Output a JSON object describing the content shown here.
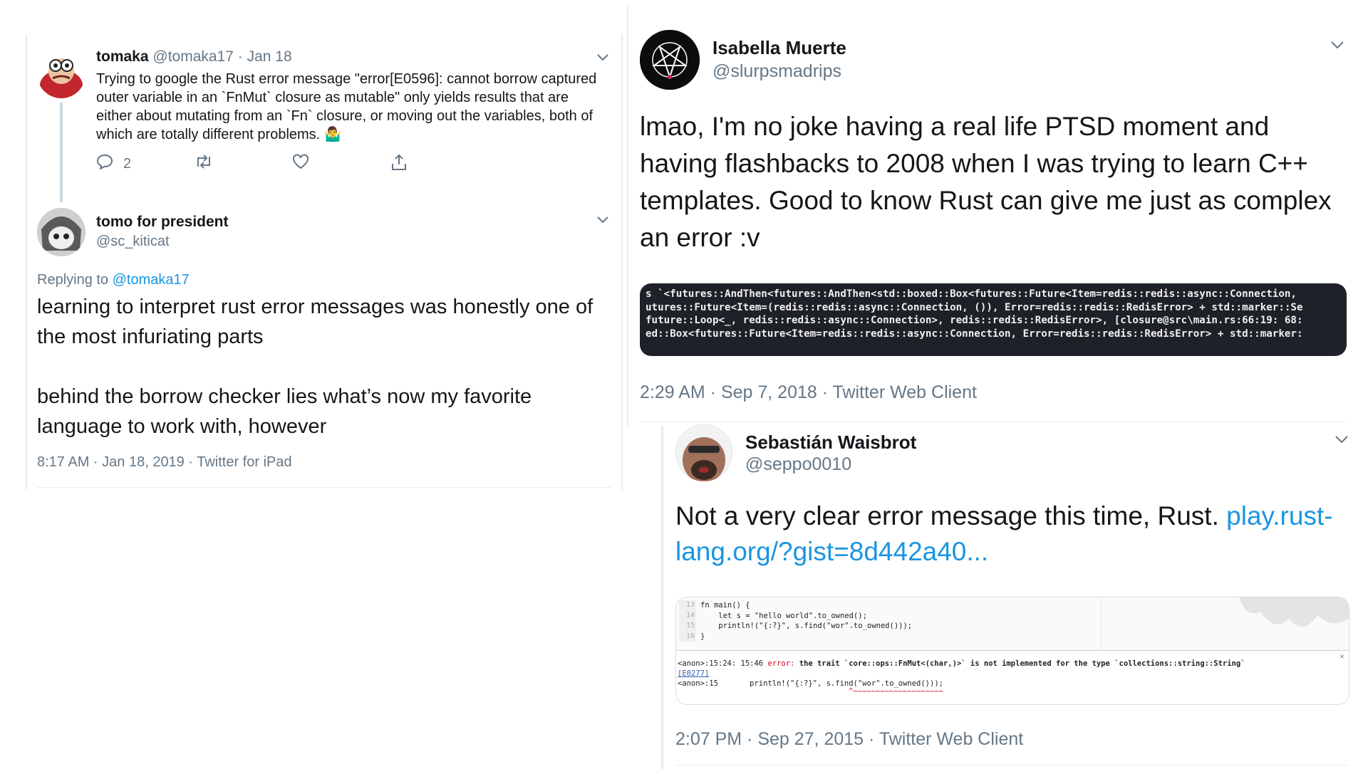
{
  "left": {
    "tweet1": {
      "display_name": "tomaka",
      "handle": "@tomaka17",
      "date": "· Jan 18",
      "text": "Trying to google the Rust error message \"error[E0596]: cannot borrow captured outer variable in an `FnMut` closure as mutable\" only yields results that are either about mutating from an `Fn` closure, or moving out the variables, both of which are totally different problems. 🤷‍♂️",
      "reply_count": "2"
    },
    "tweet2": {
      "display_name": "tomo for president",
      "handle": "@sc_kiticat",
      "replying_prefix": "Replying to ",
      "replying_to": "@tomaka17",
      "text_para1": "learning to interpret rust error messages was honestly one of the most infuriating parts",
      "text_para2": "behind the borrow checker lies what’s now my favorite language to work with, however",
      "meta": "8:17 AM · Jan 18, 2019 · Twitter for iPad"
    }
  },
  "right": {
    "tweet3": {
      "display_name": "Isabella Muerte",
      "handle": "@slurpsmadrips",
      "text": "lmao, I'm no joke having a real life PTSD moment and having flashbacks to 2008 when I was trying to learn C++ templates. Good to know Rust can give me just as complex an error :v",
      "code_lines": [
        "s `<futures::AndThen<futures::AndThen<std::boxed::Box<futures::Future<Item=redis::redis::async::Connection,",
        "utures::Future<Item=(redis::redis::async::Connection, ()), Error=redis::redis::RedisError> + std::marker::Se",
        "future::Loop<_, redis::redis::async::Connection>, redis::redis::RedisError>, [closure@src\\main.rs:66:19: 68:",
        "ed::Box<futures::Future<Item=redis::redis::async::Connection, Error=redis::redis::RedisError> + std::marker:"
      ],
      "meta": "2:29 AM · Sep 7, 2018 · Twitter Web Client"
    },
    "tweet4": {
      "display_name": "Sebastián Waisbrot",
      "handle": "@seppo0010",
      "text_prefix": "Not a very clear error message this time, Rust. ",
      "link": "play.rust-lang.org/?gist=8d442a40...",
      "code": {
        "line_numbers": [
          "13",
          "14",
          "15",
          "16"
        ],
        "lines": [
          "fn main() {",
          "    let s = \"hello world\".to_owned();",
          "    println!(\"{:?}\", s.find(\"wor\".to_owned()));",
          "}"
        ],
        "error_loc": "<anon>:15:24: 15:46 ",
        "error_word": "error:",
        "error_msg": " the trait `core::ops::FnMut<(char,)>` is not implemented for the type `collections::string::String`",
        "error_code": "[E0277]",
        "anon_line": "<anon>:15       println!(\"{:?}\", s.find(\"wor\".to_owned()));",
        "squiggle": "^~~~~~~~~~~~~~~~~~~~~",
        "close": "×"
      },
      "meta": "2:07 PM · Sep 27, 2015 · Twitter Web Client"
    }
  },
  "icons": [
    "reply-icon",
    "retweet-icon",
    "like-icon",
    "share-icon",
    "chevron-down-icon",
    "pentagram-icon"
  ],
  "colors": {
    "link": "#1b95e0",
    "muted": "#657786",
    "text": "#14171a",
    "code_bg": "#1e2128",
    "error_red": "#d0021b"
  }
}
